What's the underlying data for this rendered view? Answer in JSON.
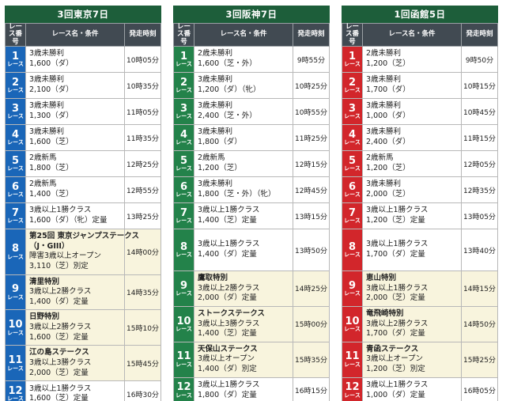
{
  "header": {
    "race_col": "レース番号",
    "name_col": "レース名・条件",
    "time_col": "発走時刻",
    "race_suffix": "レース"
  },
  "venues": [
    {
      "title": "3回東京7日",
      "color": "#1a66b8",
      "races": [
        {
          "num": "1",
          "lines": [
            "3歳未勝利",
            "1,600（ダ）"
          ],
          "time": "10時05分",
          "special": false
        },
        {
          "num": "2",
          "lines": [
            "3歳未勝利",
            "2,100（ダ）"
          ],
          "time": "10時35分",
          "special": false
        },
        {
          "num": "3",
          "lines": [
            "3歳未勝利",
            "1,300（ダ）"
          ],
          "time": "11時05分",
          "special": false
        },
        {
          "num": "4",
          "lines": [
            "3歳未勝利",
            "1,600（芝）"
          ],
          "time": "11時35分",
          "special": false
        },
        {
          "num": "5",
          "lines": [
            "2歳新馬",
            "1,800（芝）"
          ],
          "time": "12時25分",
          "special": false
        },
        {
          "num": "6",
          "lines": [
            "2歳新馬",
            "1,400（芝）"
          ],
          "time": "12時55分",
          "special": false
        },
        {
          "num": "7",
          "lines": [
            "3歳以上1勝クラス",
            "1,600（ダ）（牝）定量"
          ],
          "time": "13時25分",
          "special": false
        },
        {
          "num": "8",
          "lines": [
            "第25回 東京ジャンプステークス",
            "（J・GIII）",
            "障害3歳以上オープン",
            "3,110（芝）別定"
          ],
          "time": "14時00分",
          "special": true,
          "bold_lines": 2
        },
        {
          "num": "9",
          "lines": [
            "清里特別",
            "3歳以上2勝クラス",
            "1,400（ダ）定量"
          ],
          "time": "14時35分",
          "special": true,
          "bold_lines": 1
        },
        {
          "num": "10",
          "lines": [
            "日野特別",
            "3歳以上2勝クラス",
            "1,600（芝）定量"
          ],
          "time": "15時10分",
          "special": true,
          "bold_lines": 1
        },
        {
          "num": "11",
          "lines": [
            "江の島ステークス",
            "3歳以上3勝クラス",
            "2,000（芝）定量"
          ],
          "time": "15時45分",
          "special": true,
          "bold_lines": 1
        },
        {
          "num": "12",
          "lines": [
            "3歳以上1勝クラス",
            "1,600（芝）定量"
          ],
          "time": "16時30分",
          "special": false
        }
      ]
    },
    {
      "title": "3回阪神7日",
      "color": "#23824a",
      "races": [
        {
          "num": "1",
          "lines": [
            "2歳未勝利",
            "1,600（芝・外）"
          ],
          "time": "9時55分",
          "special": false
        },
        {
          "num": "2",
          "lines": [
            "3歳未勝利",
            "1,200（ダ）（牝）"
          ],
          "time": "10時25分",
          "special": false
        },
        {
          "num": "3",
          "lines": [
            "3歳未勝利",
            "2,400（芝・外）"
          ],
          "time": "10時55分",
          "special": false
        },
        {
          "num": "4",
          "lines": [
            "3歳未勝利",
            "1,800（ダ）"
          ],
          "time": "11時25分",
          "special": false
        },
        {
          "num": "5",
          "lines": [
            "2歳新馬",
            "1,200（芝）"
          ],
          "time": "12時15分",
          "special": false
        },
        {
          "num": "6",
          "lines": [
            "3歳未勝利",
            "1,800（芝・外）（牝）"
          ],
          "time": "12時45分",
          "special": false
        },
        {
          "num": "7",
          "lines": [
            "3歳以上1勝クラス",
            "1,400（芝）定量"
          ],
          "time": "13時15分",
          "special": false
        },
        {
          "num": "8",
          "lines": [
            "3歳以上1勝クラス",
            "1,400（ダ）定量"
          ],
          "time": "13時50分",
          "special": false
        },
        {
          "num": "9",
          "lines": [
            "鷹取特別",
            "3歳以上2勝クラス",
            "2,000（ダ）定量"
          ],
          "time": "14時25分",
          "special": true,
          "bold_lines": 1
        },
        {
          "num": "10",
          "lines": [
            "ストークステークス",
            "3歳以上3勝クラス",
            "1,400（芝）定量"
          ],
          "time": "15時00分",
          "special": true,
          "bold_lines": 1
        },
        {
          "num": "11",
          "lines": [
            "天保山ステークス",
            "3歳以上オープン",
            "1,400（ダ）別定"
          ],
          "time": "15時35分",
          "special": true,
          "bold_lines": 1
        },
        {
          "num": "12",
          "lines": [
            "3歳以上1勝クラス",
            "1,800（ダ）定量"
          ],
          "time": "16時15分",
          "special": false
        }
      ]
    },
    {
      "title": "1回函館5日",
      "color": "#d2262b",
      "races": [
        {
          "num": "1",
          "lines": [
            "2歳未勝利",
            "1,200（芝）"
          ],
          "time": "9時50分",
          "special": false
        },
        {
          "num": "2",
          "lines": [
            "3歳未勝利",
            "1,700（ダ）"
          ],
          "time": "10時15分",
          "special": false
        },
        {
          "num": "3",
          "lines": [
            "3歳未勝利",
            "1,000（ダ）"
          ],
          "time": "10時45分",
          "special": false
        },
        {
          "num": "4",
          "lines": [
            "3歳未勝利",
            "2,400（ダ）"
          ],
          "time": "11時15分",
          "special": false
        },
        {
          "num": "5",
          "lines": [
            "2歳新馬",
            "1,200（芝）"
          ],
          "time": "12時05分",
          "special": false
        },
        {
          "num": "6",
          "lines": [
            "3歳未勝利",
            "2,000（芝）"
          ],
          "time": "12時35分",
          "special": false
        },
        {
          "num": "7",
          "lines": [
            "3歳以上1勝クラス",
            "1,200（芝）定量"
          ],
          "time": "13時05分",
          "special": false
        },
        {
          "num": "8",
          "lines": [
            "3歳以上1勝クラス",
            "1,700（ダ）定量"
          ],
          "time": "13時40分",
          "special": false
        },
        {
          "num": "9",
          "lines": [
            "恵山特別",
            "3歳以上1勝クラス",
            "2,000（芝）定量"
          ],
          "time": "14時15分",
          "special": true,
          "bold_lines": 1
        },
        {
          "num": "10",
          "lines": [
            "竜飛崎特別",
            "3歳以上2勝クラス",
            "1,700（ダ）定量"
          ],
          "time": "14時50分",
          "special": true,
          "bold_lines": 1
        },
        {
          "num": "11",
          "lines": [
            "青函ステークス",
            "3歳以上オープン",
            "1,200（芝）別定"
          ],
          "time": "15時25分",
          "special": true,
          "bold_lines": 1
        },
        {
          "num": "12",
          "lines": [
            "3歳以上1勝クラス",
            "1,000（ダ）定量"
          ],
          "time": "16時05分",
          "special": false
        }
      ]
    }
  ]
}
